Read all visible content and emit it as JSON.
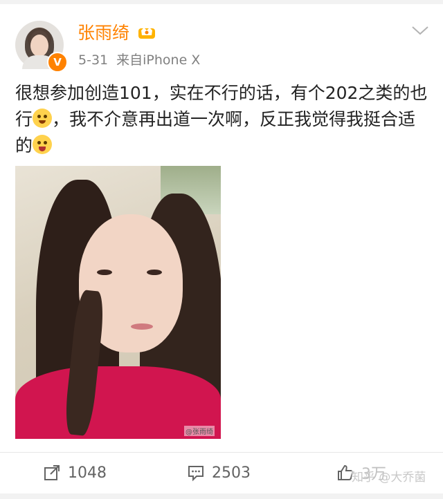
{
  "post": {
    "username": "张雨绮",
    "verified_badge": "V",
    "date": "5-31",
    "source": "来自iPhone X",
    "text_part1": "很想参加创造101，实在不行的话，有个202之类的也行",
    "text_part2": "，我不介意再出道一次啊，反正我觉得我挺合适的",
    "image_watermark": "@张雨绮"
  },
  "icons": {
    "vip": "vip-crown-icon",
    "menu": "chevron-down-icon",
    "emoji1": "smirk-emoji-icon",
    "emoji2": "tongue-emoji-icon",
    "repost": "repost-icon",
    "comment": "comment-icon",
    "like": "thumbs-up-icon"
  },
  "actions": {
    "repost_count": "1048",
    "comment_count": "2503",
    "like_count": "3万"
  },
  "overlay": {
    "zhihu_watermark": "知乎 @大乔菌"
  },
  "colors": {
    "username": "#ff8200",
    "badge": "#ff8200",
    "meta": "#808080",
    "action": "#636363"
  }
}
